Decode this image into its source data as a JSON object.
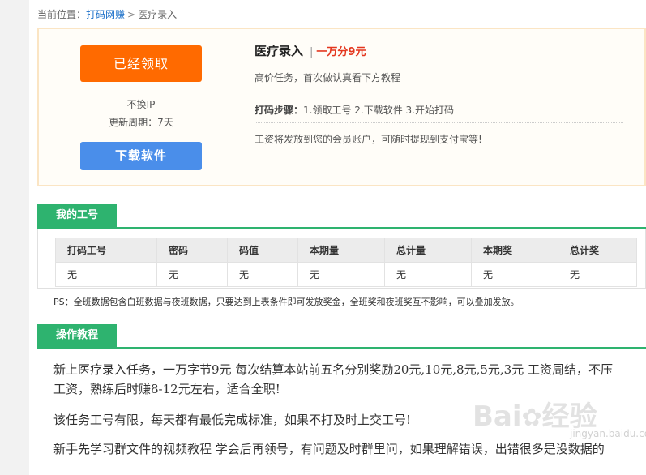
{
  "breadcrumb": {
    "prefix": "当前位置：",
    "home": "打码网赚",
    "separator": ">",
    "current": "医疗录入"
  },
  "task": {
    "claimed_button": "已经领取",
    "ip_note": "不换IP",
    "cycle_note": "更新周期：7天",
    "download_button": "下载软件",
    "title": "医疗录入",
    "title_separator": "|",
    "price": "一万分9元",
    "subtitle": "高价任务，首次做认真看下方教程",
    "steps_label": "打码步骤：",
    "steps_value": "1.领取工号 2.下载软件 3.开始打码",
    "payout_note": "工资将发放到您的会员账户，可随时提现到支付宝等!"
  },
  "my_id_section": {
    "title": "我的工号",
    "columns": [
      "打码工号",
      "密码",
      "码值",
      "本期量",
      "总计量",
      "本期奖",
      "总计奖"
    ],
    "rows": [
      [
        "无",
        "无",
        "无",
        "无",
        "无",
        "无",
        "无"
      ]
    ],
    "note": "PS：全班数据包含白班数据与夜班数据，只要达到上表条件即可发放奖金，全班奖和夜班奖互不影响，可以叠加发放。"
  },
  "tutorial_section": {
    "title": "操作教程",
    "paragraphs": [
      "新上医疗录入任务，一万字节9元 每次结算本站前五名分别奖励20元,10元,8元,5元,3元 工资周结，不压工资，熟练后时赚8-12元左右，适合全职!",
      "该任务工号有限，每天都有最低完成标准，如果不打及时上交工号!",
      "新手先学习群文件的视频教程 学会后再领号，有问题及时群里问，如果理解错误，出错很多是没数据的"
    ]
  },
  "watermark": {
    "brand_left": "Bai",
    "brand_right": "经验",
    "domain": "jingyan.baidu.com"
  },
  "colors": {
    "claimed_button": "#ff6a00",
    "download_button": "#4a8eea",
    "section_green": "#2eb36f",
    "price_red": "#e4361e",
    "link_blue": "#1a6fc9"
  }
}
